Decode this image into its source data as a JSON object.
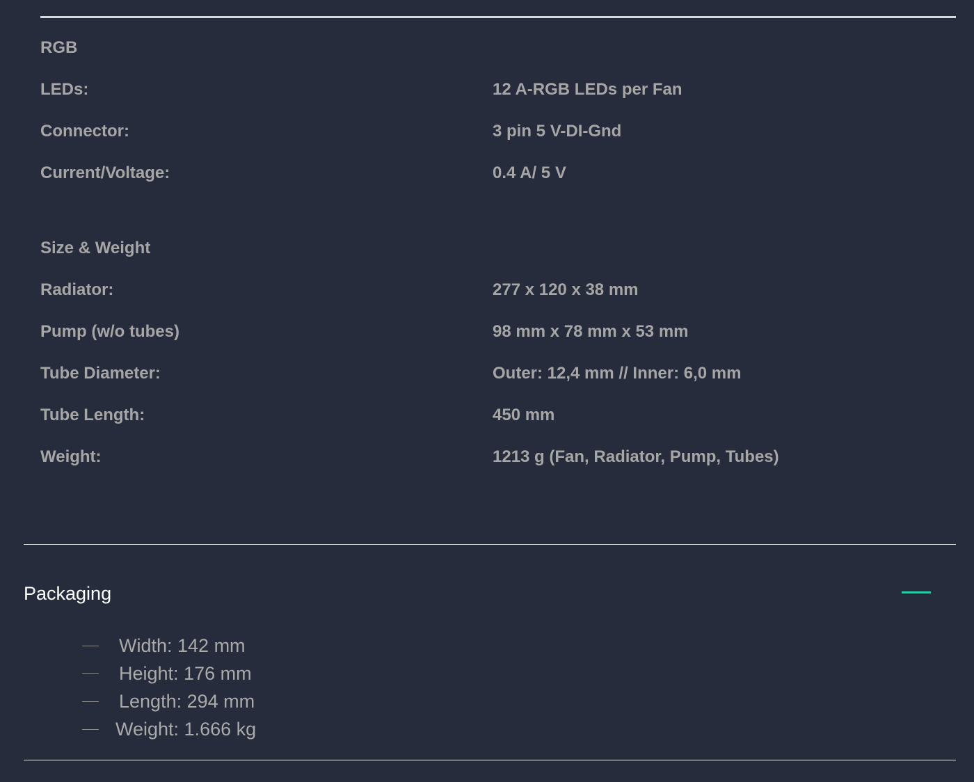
{
  "rgb_section": {
    "heading": "RGB",
    "rows": [
      {
        "label": "LEDs:",
        "value": "12 A-RGB LEDs per Fan"
      },
      {
        "label": "Connector:",
        "value": "3 pin 5 V-DI-Gnd"
      },
      {
        "label": "Current/Voltage:",
        "value": "0.4 A/ 5 V"
      }
    ]
  },
  "size_weight_section": {
    "heading": "Size & Weight",
    "rows": [
      {
        "label": "Radiator:",
        "value": "277 x 120 x 38 mm"
      },
      {
        "label": "Pump (w/o tubes)",
        "value": "98 mm x 78 mm x 53 mm"
      },
      {
        "label": "Tube Diameter:",
        "value": "Outer: 12,4 mm // Inner: 6,0 mm"
      },
      {
        "label": "Tube Length:",
        "value": "450 mm"
      },
      {
        "label": "Weight:",
        "value": "1213 g (Fan, Radiator, Pump, Tubes)"
      }
    ]
  },
  "packaging": {
    "title": "Packaging",
    "toggle_icon": "minus-icon",
    "accent_color": "#27c8a4",
    "items": [
      "Width: 142 mm",
      "Height: 176 mm",
      "Length: 294 mm",
      "Weight: 1.666 kg"
    ]
  }
}
